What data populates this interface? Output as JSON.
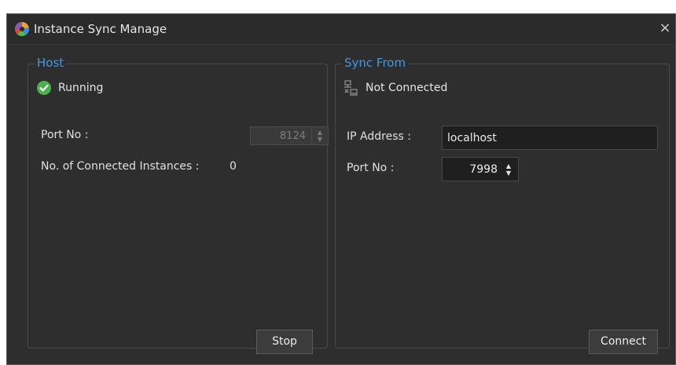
{
  "window": {
    "title": "Instance Sync Manage",
    "close_glyph": "×"
  },
  "host": {
    "title": "Host",
    "status": "Running",
    "status_icon": "check-circle-icon",
    "port_label": "Port No :",
    "port_value": "8124",
    "instances_label": "No. of Connected Instances :",
    "instances_value": "0",
    "stop_label": "Stop"
  },
  "sync_from": {
    "title": "Sync From",
    "status": "Not Connected",
    "status_icon": "network-disconnected-icon",
    "ip_label": "IP Address :",
    "ip_value": "localhost",
    "port_label": "Port No :",
    "port_value": "7998",
    "connect_label": "Connect"
  },
  "colors": {
    "accent": "#3d9ae8",
    "success": "#4caf50",
    "background": "#2e2e2e"
  }
}
